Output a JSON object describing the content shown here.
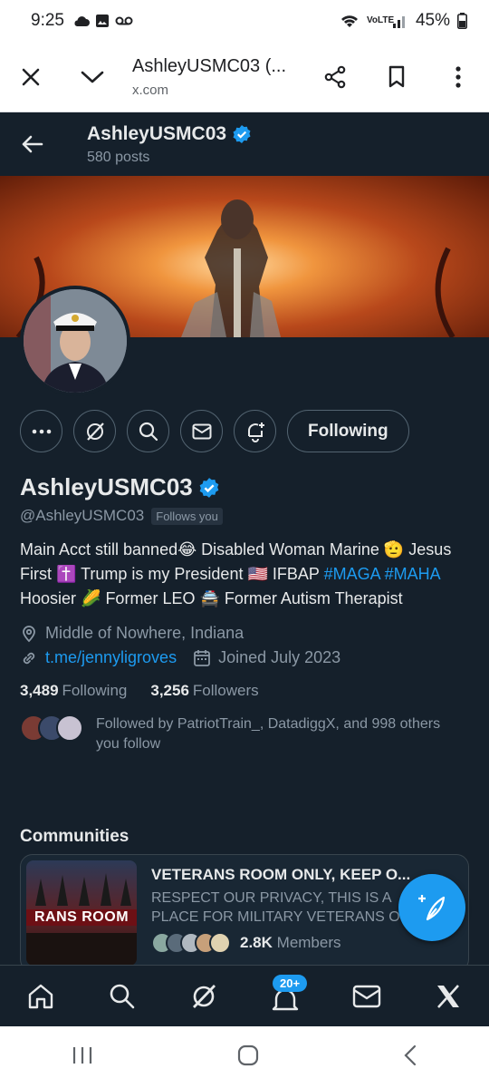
{
  "status_bar": {
    "time": "9:25",
    "network": "VoLTE",
    "battery": "45%"
  },
  "browser": {
    "title": "AshleyUSMC03 (...",
    "domain": "x.com",
    "icons": [
      "close-icon",
      "chevron-down-icon",
      "share-icon",
      "bookmark-icon",
      "more-vert-icon"
    ]
  },
  "profile": {
    "top_name": "AshleyUSMC03",
    "post_count": "580 posts",
    "display_name": "AshleyUSMC03",
    "handle": "@AshleyUSMC03",
    "follows_you": "Follows you",
    "following_button": "Following",
    "bio_parts": {
      "p1": "Main Acct still banned😂 Disabled Woman Marine 🫡 Jesus First ✝️ Trump is my President 🇺🇸 IFBAP ",
      "tag1": "#MAGA",
      "tag2": "#MAHA",
      "p2": " Hoosier 🌽 Former LEO 🚔 Former Autism Therapist"
    },
    "location": "Middle of Nowhere, Indiana",
    "website": "t.me/jennyligroves",
    "joined": "Joined July 2023",
    "following_count": "3,489",
    "following_label": "Following",
    "followers_count": "3,256",
    "followers_label": "Followers",
    "followed_by_line1": "Followed by PatriotTrain_, DatadiggX, and 998 others",
    "followed_by_line2": "you follow"
  },
  "communities": {
    "heading": "Communities",
    "title": "VETERANS ROOM ONLY, KEEP O...",
    "desc_line1": "RESPECT OUR PRIVACY, THIS IS A",
    "desc_line2": "PLACE FOR MILITARY VETERANS O",
    "image_label": "RANS ROOM",
    "members_count": "2.8K",
    "members_label": "Members"
  },
  "bottom_nav": {
    "notification_badge": "20+"
  },
  "colors": {
    "accent": "#1d9bf0",
    "background": "#15202b",
    "muted": "#8b98a5"
  }
}
